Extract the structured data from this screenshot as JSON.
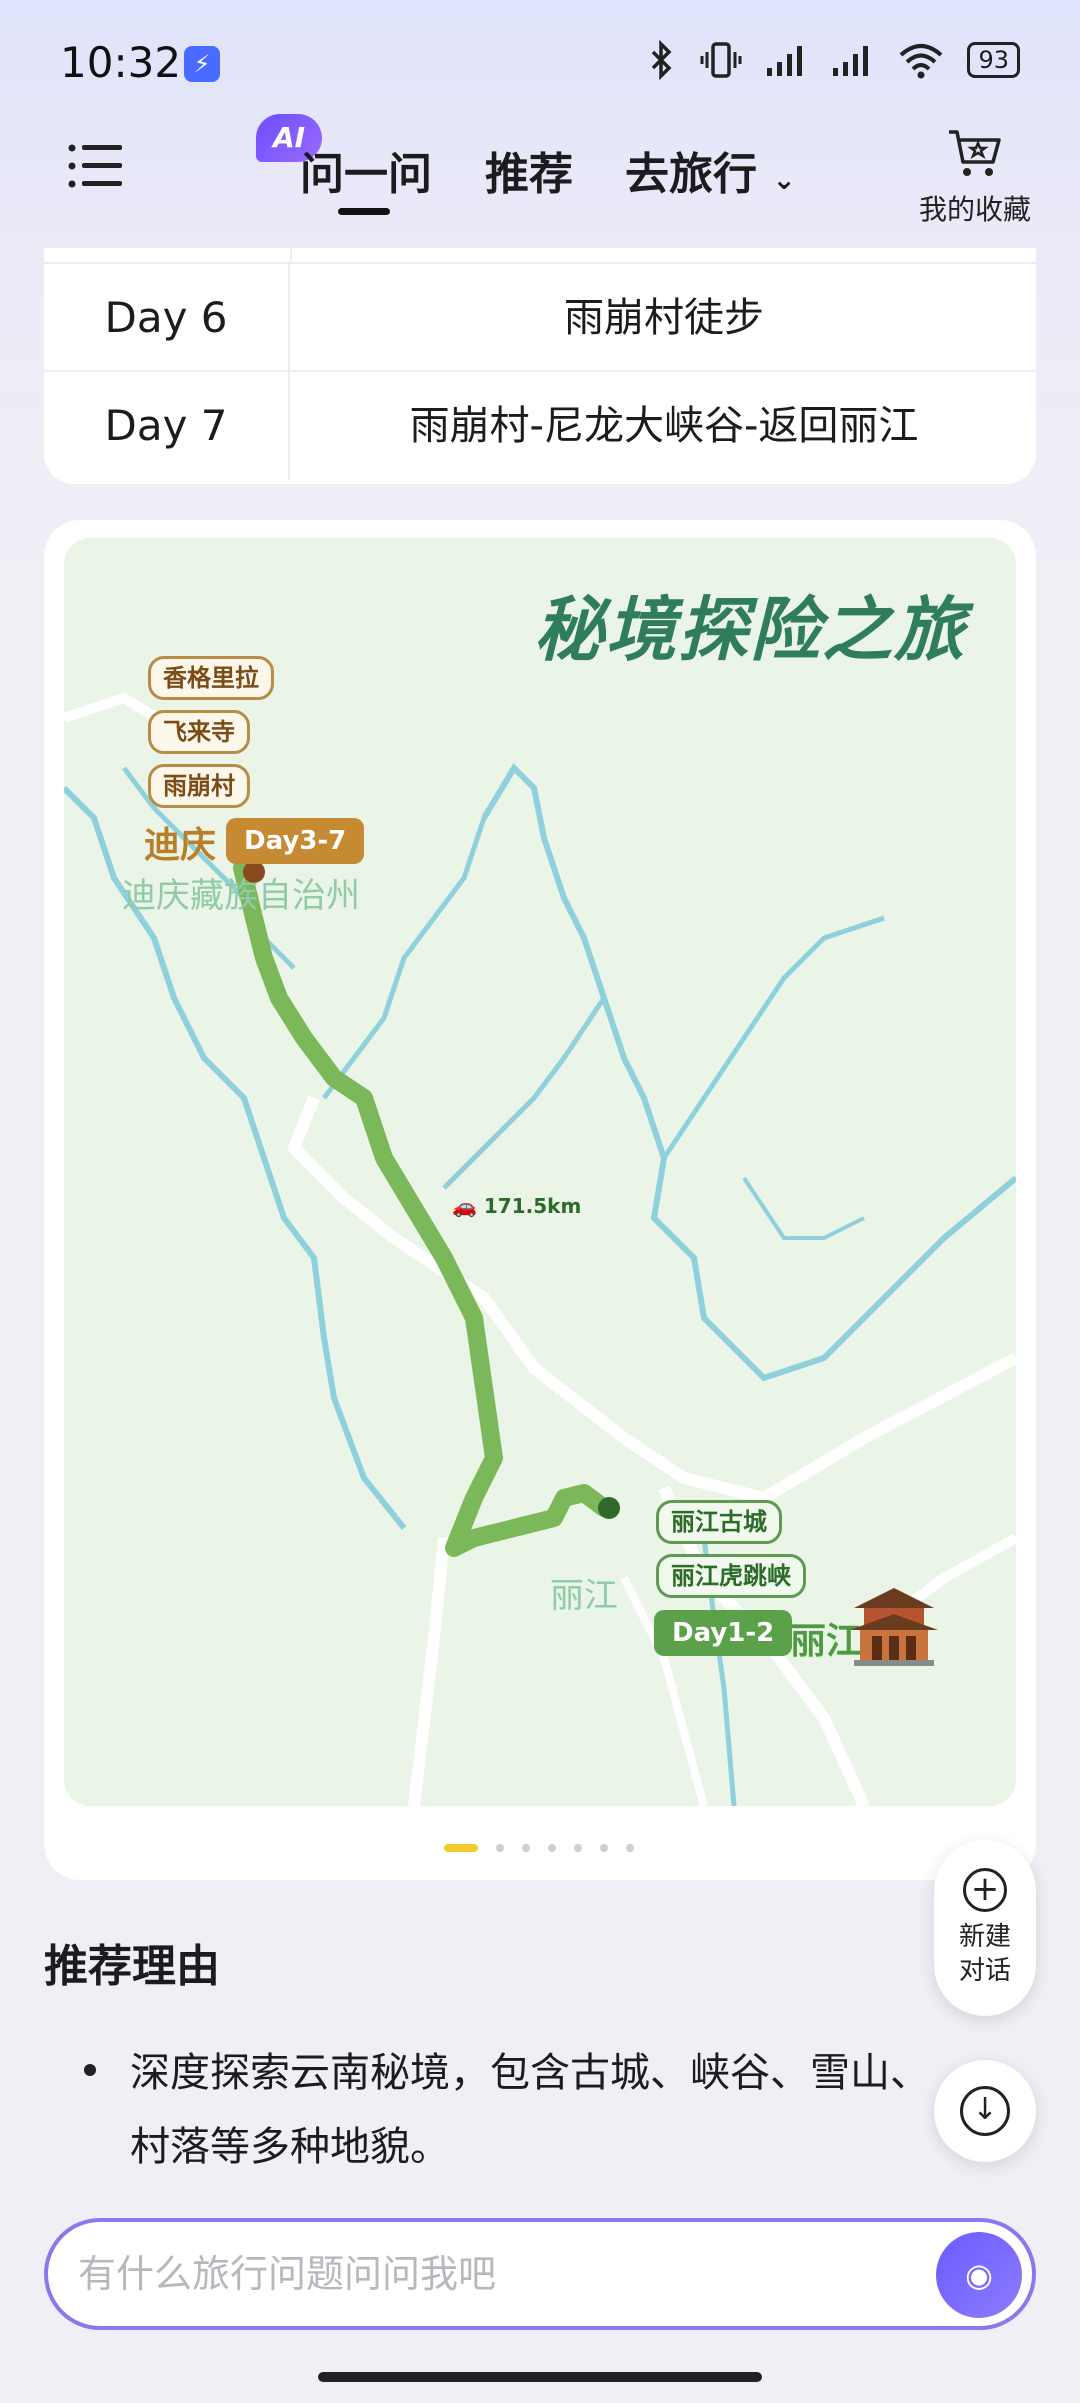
{
  "status_bar": {
    "time": "10:32",
    "battery": "93"
  },
  "header": {
    "ai_badge": "AI",
    "tabs": [
      {
        "label": "问一问"
      },
      {
        "label": "推荐"
      },
      {
        "label": "去旅行"
      }
    ],
    "favorites_label": "我的收藏"
  },
  "itinerary": [
    {
      "day": "Day 6",
      "desc": "雨崩村徒步"
    },
    {
      "day": "Day 7",
      "desc": "雨崩村-尼龙大峡谷-返回丽江"
    }
  ],
  "map": {
    "title": "秘境探险之旅",
    "north_pois": [
      "香格里拉",
      "飞来寺",
      "雨崩村"
    ],
    "north_place": "迪庆",
    "north_day_badge": "Day3-7",
    "north_region": "迪庆藏族自治州",
    "distance": "171.5km",
    "south_pois": [
      "丽江古城",
      "丽江虎跳峡"
    ],
    "south_day_badge": "Day1-2",
    "south_place": "丽江",
    "south_map_label": "丽江",
    "colors": {
      "route": "#7ab85a",
      "river": "#8fd0dd",
      "north_badge": "#c68a33",
      "south_badge": "#5aa14a"
    },
    "carousel_pages": 7,
    "carousel_active": 0
  },
  "floating": {
    "new_chat_line1": "新建",
    "new_chat_line2": "对话"
  },
  "recommendation": {
    "title": "推荐理由",
    "items": [
      "深度探索云南秘境，包含古城、峡谷、雪山、村落等多种地貌。"
    ]
  },
  "input": {
    "placeholder": "有什么旅行问题问问我吧"
  }
}
